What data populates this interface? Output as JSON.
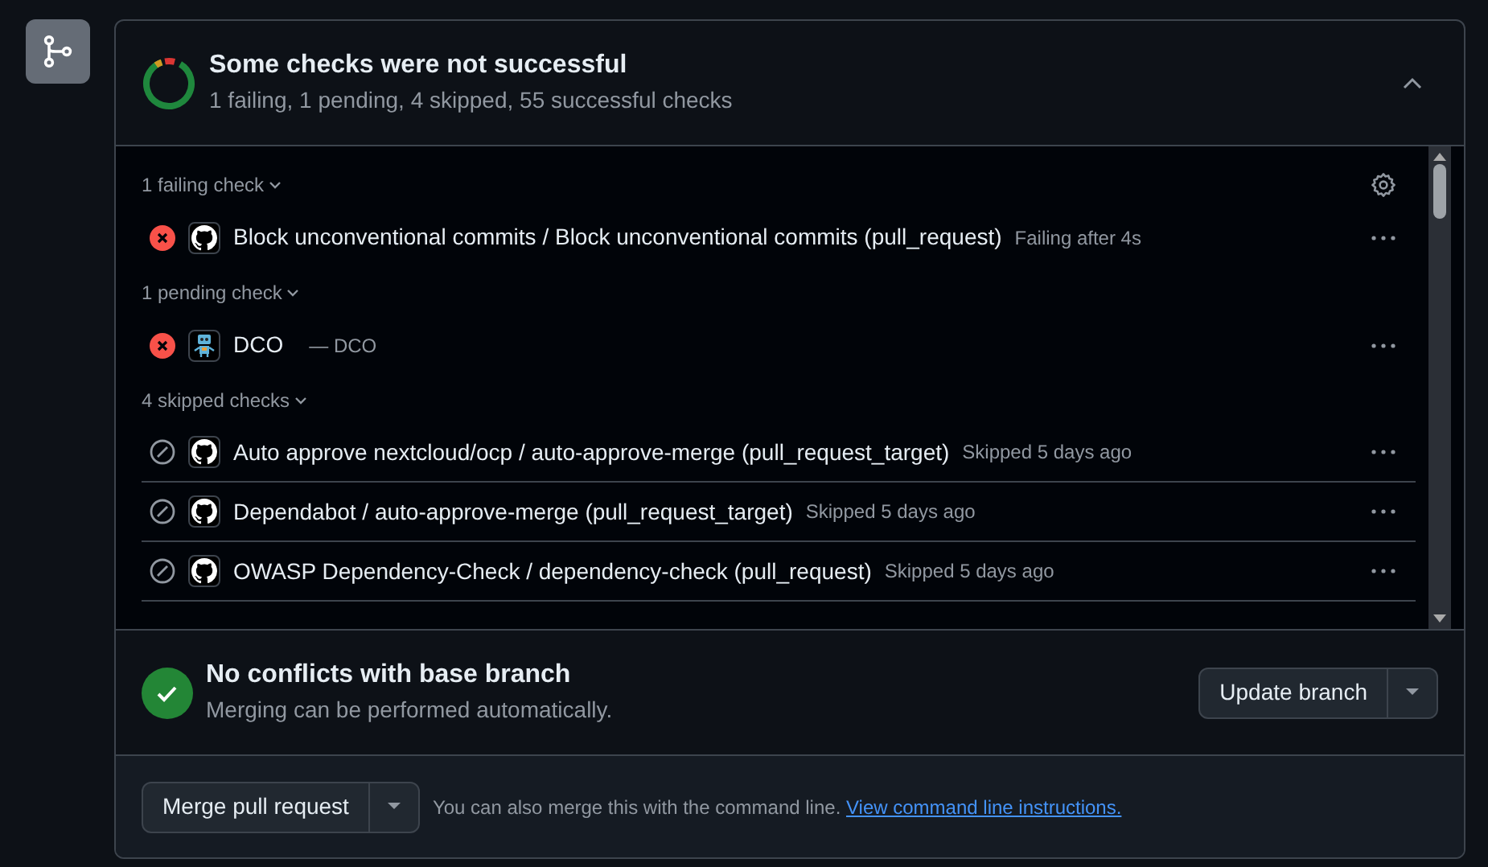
{
  "summary": {
    "title": "Some checks were not successful",
    "subtitle": "1 failing, 1 pending, 4 skipped, 55 successful checks",
    "expanded": true
  },
  "check_groups": [
    {
      "label": "1 failing check",
      "checks": [
        {
          "status": {
            "kind": "failure"
          },
          "avatar": {
            "kind": "github"
          },
          "name": "Block unconventional commits / Block unconventional commits (pull_request)",
          "detail": "Failing after 4s"
        }
      ]
    },
    {
      "label": "1 pending check",
      "checks": [
        {
          "status": {
            "kind": "failure"
          },
          "avatar": {
            "kind": "robot"
          },
          "name": "DCO",
          "detail": "— DCO"
        }
      ]
    },
    {
      "label": "4 skipped checks",
      "checks": [
        {
          "status": {
            "kind": "skipped"
          },
          "avatar": {
            "kind": "github"
          },
          "name": "Auto approve nextcloud/ocp / auto-approve-merge (pull_request_target)",
          "detail": "Skipped 5 days ago"
        },
        {
          "status": {
            "kind": "skipped"
          },
          "avatar": {
            "kind": "github"
          },
          "name": "Dependabot / auto-approve-merge (pull_request_target)",
          "detail": "Skipped 5 days ago"
        },
        {
          "status": {
            "kind": "skipped"
          },
          "avatar": {
            "kind": "github"
          },
          "name": "OWASP Dependency-Check / dependency-check (pull_request)",
          "detail": "Skipped 5 days ago"
        }
      ]
    }
  ],
  "conflicts": {
    "title": "No conflicts with base branch",
    "subtitle": "Merging can be performed automatically.",
    "button": "Update branch"
  },
  "merge": {
    "button": "Merge pull request",
    "note": "You can also merge this with the command line.",
    "link": "View command line instructions."
  }
}
